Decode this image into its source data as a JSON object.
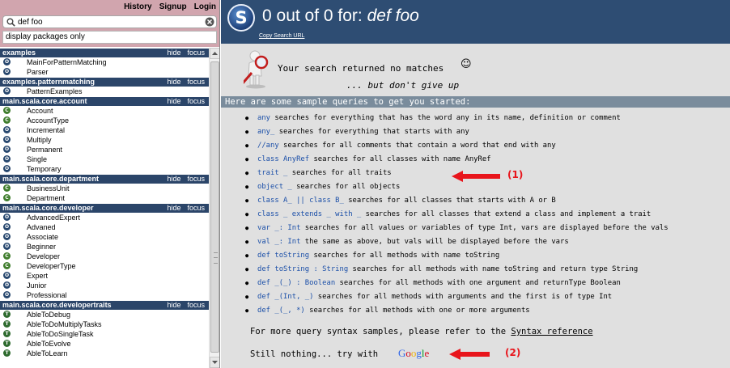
{
  "topnav": {
    "history": "History",
    "signup": "Signup",
    "login": "Login"
  },
  "search": {
    "query": "def foo",
    "packages_placeholder": "display packages only"
  },
  "packages": [
    {
      "name": "examples",
      "hide": "hide",
      "focus": "focus",
      "items": [
        {
          "badge": "O",
          "kind": "o",
          "name": "MainForPatternMatching"
        },
        {
          "badge": "O",
          "kind": "o",
          "name": "Parser"
        }
      ]
    },
    {
      "name": "examples.patternmatching",
      "hide": "hide",
      "focus": "focus",
      "items": [
        {
          "badge": "O",
          "kind": "o",
          "name": "PatternExamples"
        }
      ]
    },
    {
      "name": "main.scala.core.account",
      "hide": "hide",
      "focus": "focus",
      "items": [
        {
          "badge": "C",
          "kind": "c",
          "name": "Account"
        },
        {
          "badge": "C",
          "kind": "c",
          "name": "AccountType"
        },
        {
          "badge": "O",
          "kind": "o",
          "name": "Incremental"
        },
        {
          "badge": "O",
          "kind": "o",
          "name": "Multiply"
        },
        {
          "badge": "O",
          "kind": "o",
          "name": "Permanent"
        },
        {
          "badge": "O",
          "kind": "o",
          "name": "Single"
        },
        {
          "badge": "O",
          "kind": "o",
          "name": "Temporary"
        }
      ]
    },
    {
      "name": "main.scala.core.department",
      "hide": "hide",
      "focus": "focus",
      "items": [
        {
          "badge": "C",
          "kind": "c",
          "name": "BusinessUnit"
        },
        {
          "badge": "C",
          "kind": "c",
          "name": "Department"
        }
      ]
    },
    {
      "name": "main.scala.core.developer",
      "hide": "hide",
      "focus": "focus",
      "items": [
        {
          "badge": "O",
          "kind": "o",
          "name": "AdvancedExpert"
        },
        {
          "badge": "O",
          "kind": "o",
          "name": "Advaned"
        },
        {
          "badge": "O",
          "kind": "o",
          "name": "Associate"
        },
        {
          "badge": "O",
          "kind": "o",
          "name": "Beginner"
        },
        {
          "badge": "C",
          "kind": "c",
          "name": "Developer"
        },
        {
          "badge": "C",
          "kind": "c",
          "name": "DeveloperType"
        },
        {
          "badge": "O",
          "kind": "o",
          "name": "Expert"
        },
        {
          "badge": "O",
          "kind": "o",
          "name": "Junior"
        },
        {
          "badge": "O",
          "kind": "o",
          "name": "Professional"
        }
      ]
    },
    {
      "name": "main.scala.core.developertraits",
      "hide": "hide",
      "focus": "focus",
      "items": [
        {
          "badge": "T",
          "kind": "t",
          "name": "AbleToDebug"
        },
        {
          "badge": "T",
          "kind": "t",
          "name": "AbleToDoMultiplyTasks"
        },
        {
          "badge": "T",
          "kind": "t",
          "name": "AbleToDoSingleTask"
        },
        {
          "badge": "T",
          "kind": "t",
          "name": "AbleToEvolve"
        },
        {
          "badge": "T",
          "kind": "t",
          "name": "AbleToLearn"
        }
      ]
    }
  ],
  "header": {
    "logo_letter": "S",
    "title_prefix": "0 out of 0 for: ",
    "title_query": "def foo",
    "copy_url": "Copy Search URL"
  },
  "no_match": {
    "line1": "Your search returned no matches",
    "smiley": "☺",
    "line2": "... but don't give up"
  },
  "sample_header": "Here are some sample queries to get you started:",
  "examples": [
    {
      "code": "any",
      "desc": " searches for everything that has the word any in its name, definition or comment"
    },
    {
      "code": "any_",
      "desc": " searches for everything that starts with any"
    },
    {
      "code": "//any",
      "desc": " searches for all comments that contain a word that end with any"
    },
    {
      "code": "class AnyRef",
      "desc": " searches for all classes with name AnyRef"
    },
    {
      "code": "trait _",
      "desc": " searches for all traits"
    },
    {
      "code": "object _",
      "desc": " searches for all objects"
    },
    {
      "code": "class A_ || class B_",
      "desc": " searches for all classes that starts with A or B"
    },
    {
      "code": "class _ extends _ with _",
      "desc": " searches for all classes that extend a class and implement a trait"
    },
    {
      "code": "var _: Int",
      "desc": " searches for all values or variables of type Int, vars are displayed before the vals"
    },
    {
      "code": "val _: Int",
      "desc": " the same as above, but vals will be displayed before the vars"
    },
    {
      "code": "def toString",
      "desc": " searches for all methods with name toString"
    },
    {
      "code": "def toString : String",
      "desc": " searches for all methods with name toString and return type String"
    },
    {
      "code": "def _(_) : Boolean",
      "desc": " searches for all methods with one argument and returnType Boolean"
    },
    {
      "code": "def _(Int, _)",
      "desc": " searches for all methods with arguments and the first is of type Int"
    },
    {
      "code": "def _(_, *)",
      "desc": " searches for all methods with one or more arguments"
    }
  ],
  "more": {
    "text": "For more query syntax samples, please refer to the ",
    "link": "Syntax reference"
  },
  "still": {
    "text": "Still nothing... try with",
    "google": "Google"
  },
  "annotations": {
    "a1": "(1)",
    "a2": "(2)"
  },
  "colors": {
    "header_bg": "#2e4d73",
    "package_bg": "#2b4569",
    "nav_bg": "#d1a5ae",
    "code_blue": "#1b4fa8",
    "annotation_red": "#e8151c"
  }
}
